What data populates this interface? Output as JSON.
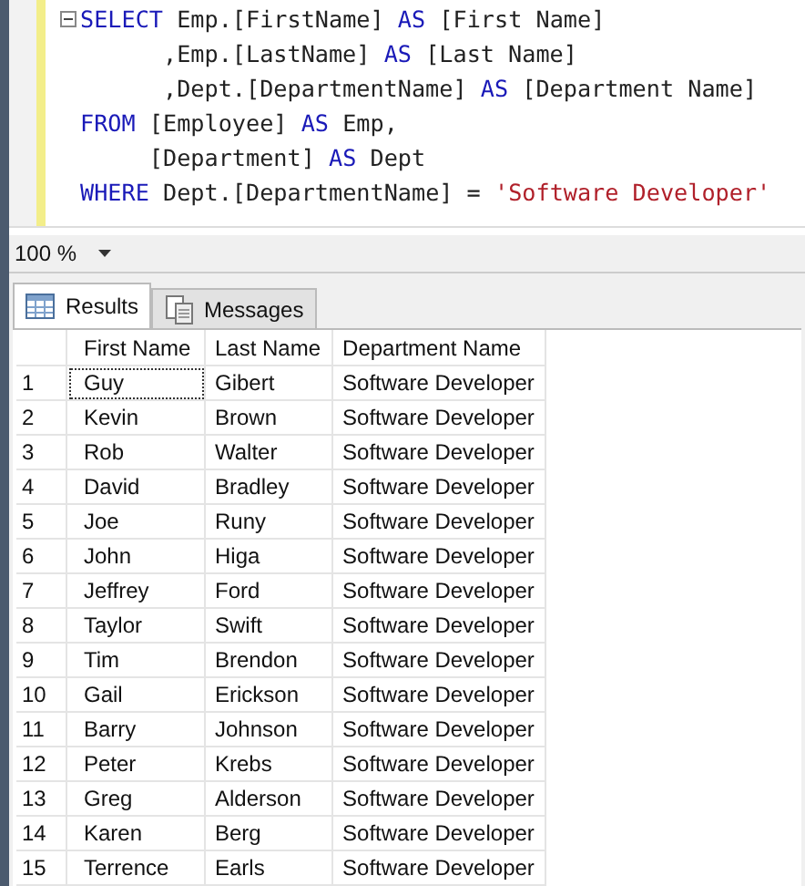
{
  "editor": {
    "lines": [
      {
        "collapsible": true,
        "tokens": [
          {
            "kind": "keyword",
            "text": "SELECT"
          },
          {
            "kind": "plain",
            "text": " Emp.[FirstName] "
          },
          {
            "kind": "keyword",
            "text": "AS"
          },
          {
            "kind": "plain",
            "text": " [First Name]"
          }
        ]
      },
      {
        "collapsible": false,
        "tokens": [
          {
            "kind": "plain",
            "text": "      ,Emp.[LastName] "
          },
          {
            "kind": "keyword",
            "text": "AS"
          },
          {
            "kind": "plain",
            "text": " [Last Name]"
          }
        ]
      },
      {
        "collapsible": false,
        "tokens": [
          {
            "kind": "plain",
            "text": "      ,Dept.[DepartmentName] "
          },
          {
            "kind": "keyword",
            "text": "AS"
          },
          {
            "kind": "plain",
            "text": " [Department Name]"
          }
        ]
      },
      {
        "collapsible": false,
        "tokens": [
          {
            "kind": "keyword",
            "text": "FROM"
          },
          {
            "kind": "plain",
            "text": " [Employee] "
          },
          {
            "kind": "keyword",
            "text": "AS"
          },
          {
            "kind": "plain",
            "text": " Emp,"
          }
        ]
      },
      {
        "collapsible": false,
        "tokens": [
          {
            "kind": "plain",
            "text": "     [Department] "
          },
          {
            "kind": "keyword",
            "text": "AS"
          },
          {
            "kind": "plain",
            "text": " Dept"
          }
        ]
      },
      {
        "collapsible": false,
        "tokens": [
          {
            "kind": "keyword",
            "text": "WHERE"
          },
          {
            "kind": "plain",
            "text": " Dept.[DepartmentName] = "
          },
          {
            "kind": "string",
            "text": "'Software Developer'"
          }
        ]
      }
    ]
  },
  "zoom": {
    "value": "100 %"
  },
  "tabs": [
    {
      "label": "Results",
      "selected": true
    },
    {
      "label": "Messages",
      "selected": false
    }
  ],
  "grid": {
    "columns": [
      "First Name",
      "Last Name",
      "Department Name"
    ],
    "rows": [
      {
        "number": "1",
        "cells": [
          {
            "text": "Guy",
            "focused": true
          },
          {
            "text": "Gibert",
            "focused": false
          },
          {
            "text": "Software Developer",
            "focused": false
          }
        ]
      },
      {
        "number": "2",
        "cells": [
          {
            "text": "Kevin",
            "focused": false
          },
          {
            "text": "Brown",
            "focused": false
          },
          {
            "text": "Software Developer",
            "focused": false
          }
        ]
      },
      {
        "number": "3",
        "cells": [
          {
            "text": "Rob",
            "focused": false
          },
          {
            "text": "Walter",
            "focused": false
          },
          {
            "text": "Software Developer",
            "focused": false
          }
        ]
      },
      {
        "number": "4",
        "cells": [
          {
            "text": "David",
            "focused": false
          },
          {
            "text": "Bradley",
            "focused": false
          },
          {
            "text": "Software Developer",
            "focused": false
          }
        ]
      },
      {
        "number": "5",
        "cells": [
          {
            "text": "Joe",
            "focused": false
          },
          {
            "text": "Runy",
            "focused": false
          },
          {
            "text": "Software Developer",
            "focused": false
          }
        ]
      },
      {
        "number": "6",
        "cells": [
          {
            "text": "John",
            "focused": false
          },
          {
            "text": "Higa",
            "focused": false
          },
          {
            "text": "Software Developer",
            "focused": false
          }
        ]
      },
      {
        "number": "7",
        "cells": [
          {
            "text": "Jeffrey",
            "focused": false
          },
          {
            "text": "Ford",
            "focused": false
          },
          {
            "text": "Software Developer",
            "focused": false
          }
        ]
      },
      {
        "number": "8",
        "cells": [
          {
            "text": "Taylor",
            "focused": false
          },
          {
            "text": "Swift",
            "focused": false
          },
          {
            "text": "Software Developer",
            "focused": false
          }
        ]
      },
      {
        "number": "9",
        "cells": [
          {
            "text": "Tim",
            "focused": false
          },
          {
            "text": "Brendon",
            "focused": false
          },
          {
            "text": "Software Developer",
            "focused": false
          }
        ]
      },
      {
        "number": "10",
        "cells": [
          {
            "text": "Gail",
            "focused": false
          },
          {
            "text": "Erickson",
            "focused": false
          },
          {
            "text": "Software Developer",
            "focused": false
          }
        ]
      },
      {
        "number": "11",
        "cells": [
          {
            "text": "Barry",
            "focused": false
          },
          {
            "text": "Johnson",
            "focused": false
          },
          {
            "text": "Software Developer",
            "focused": false
          }
        ]
      },
      {
        "number": "12",
        "cells": [
          {
            "text": "Peter",
            "focused": false
          },
          {
            "text": "Krebs",
            "focused": false
          },
          {
            "text": "Software Developer",
            "focused": false
          }
        ]
      },
      {
        "number": "13",
        "cells": [
          {
            "text": "Greg",
            "focused": false
          },
          {
            "text": "Alderson",
            "focused": false
          },
          {
            "text": "Software Developer",
            "focused": false
          }
        ]
      },
      {
        "number": "14",
        "cells": [
          {
            "text": "Karen",
            "focused": false
          },
          {
            "text": "Berg",
            "focused": false
          },
          {
            "text": "Software Developer",
            "focused": false
          }
        ]
      },
      {
        "number": "15",
        "cells": [
          {
            "text": "Terrence",
            "focused": false
          },
          {
            "text": "Earls",
            "focused": false
          },
          {
            "text": "Software Developer",
            "focused": false
          }
        ]
      }
    ]
  }
}
